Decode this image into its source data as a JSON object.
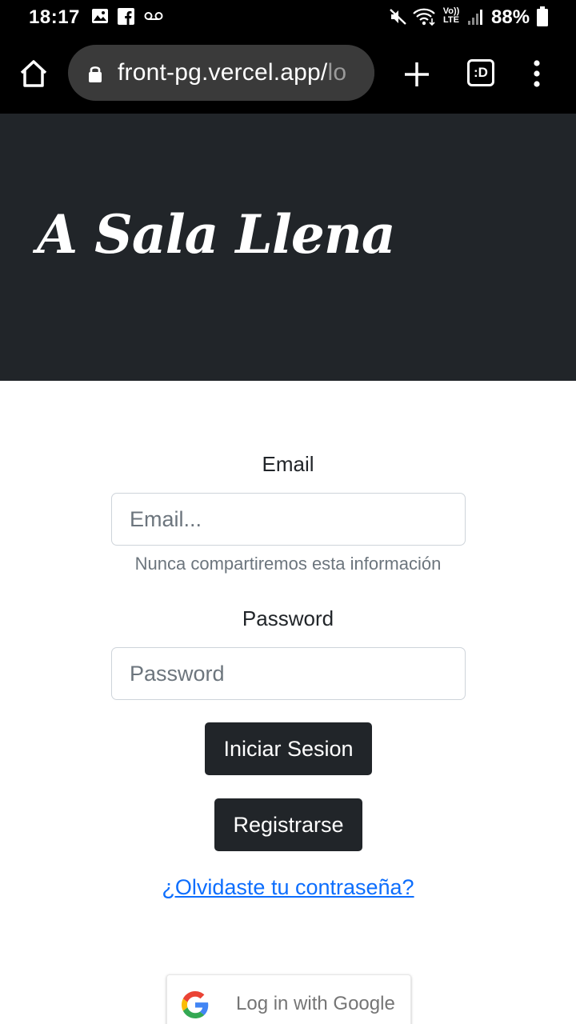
{
  "status_bar": {
    "time": "18:17",
    "battery": "88%",
    "icons": [
      "image-icon",
      "facebook-icon",
      "voicemail-icon",
      "mute-icon",
      "wifi-icon",
      "volte-icon",
      "signal-icon",
      "battery-icon"
    ],
    "volte_top": "Vo))",
    "volte_bottom": "LTE"
  },
  "browser": {
    "url_main": "front-pg.vercel.app/",
    "url_faded": "lo",
    "tabs_label": ":D"
  },
  "hero": {
    "title": "A Sala Llena",
    "background": "#212529"
  },
  "form": {
    "email_label": "Email",
    "email_placeholder": "Email...",
    "email_help": "Nunca compartiremos esta información",
    "password_label": "Password",
    "password_placeholder": "Password",
    "login_button": "Iniciar Sesion",
    "register_button": "Registrarse",
    "forgot_link": "¿Olvidaste tu contraseña?",
    "google_button": "Log in with Google"
  },
  "colors": {
    "dark": "#212529",
    "link": "#0d6efd",
    "muted": "#6c757d"
  }
}
